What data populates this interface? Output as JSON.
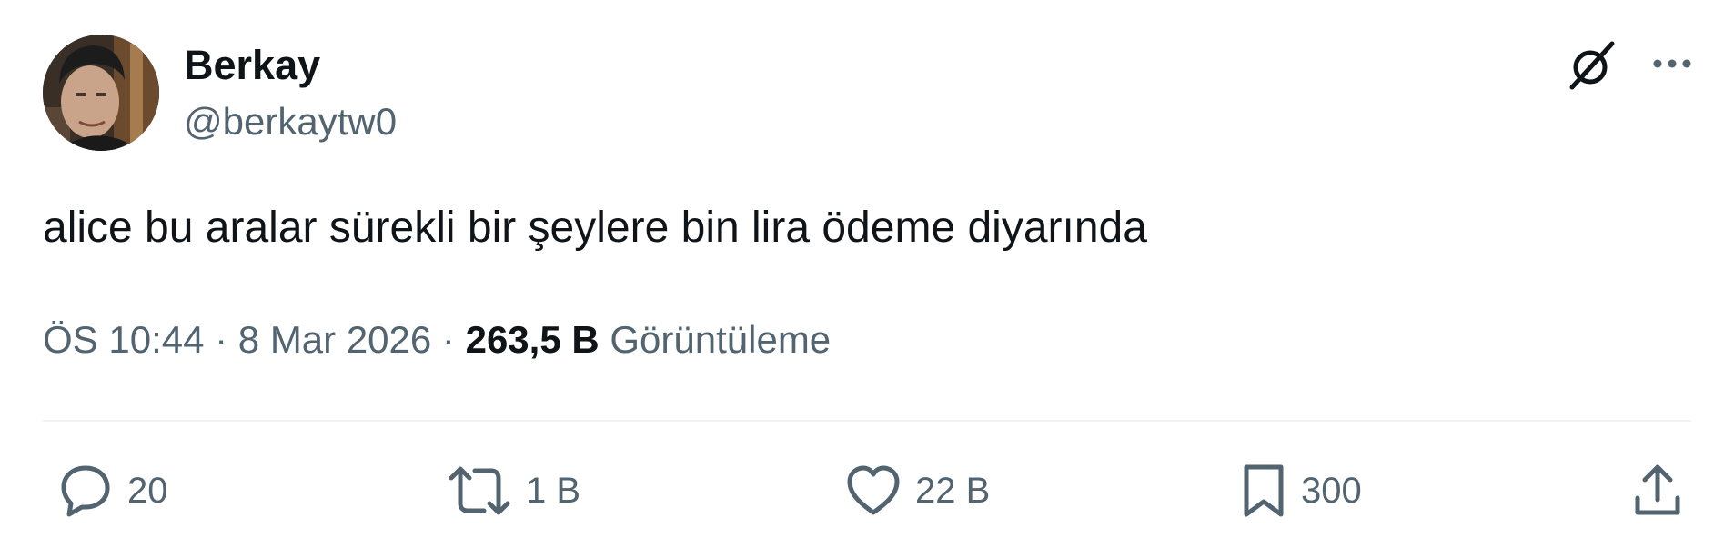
{
  "author": {
    "display_name": "Berkay",
    "handle": "@berkaytw0"
  },
  "tweet": {
    "text": "alice bu aralar sürekli bir şeylere bin lira ödeme diyarında",
    "time": "ÖS 10:44",
    "separator": " · ",
    "date": "8 Mar 2026",
    "views_count": "263,5 B",
    "views_label": "Görüntüleme"
  },
  "actions": {
    "replies": "20",
    "reposts": "1 B",
    "likes": "22 B",
    "bookmarks": "300"
  },
  "icons": {
    "header": [
      "grok-icon",
      "more-icon"
    ],
    "actions": [
      "reply-icon",
      "retweet-icon",
      "like-icon",
      "bookmark-icon",
      "share-icon"
    ]
  },
  "colors": {
    "text_primary": "#0f1419",
    "text_secondary": "#536471",
    "divider": "#eff3f4"
  }
}
